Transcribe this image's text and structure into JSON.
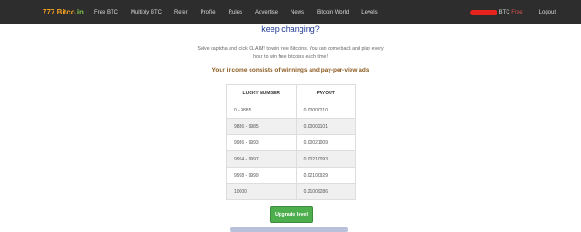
{
  "nav": {
    "brand_num": "777",
    "brand_name": "Bitco",
    "brand_tld": ".in",
    "links": [
      "Free BTC",
      "Multiply BTC",
      "Refer",
      "Profile",
      "Rules",
      "Advertise",
      "News",
      "Bitcoin World",
      "Levels"
    ],
    "btc_label": "BTC",
    "free_label": "Free",
    "logout": "Logout"
  },
  "main": {
    "headline": "keep changing?",
    "intro": "Solve captcha and click CLAIM! to win free Bitcoins. You can come back and play every hour to win free bitcoins each time!",
    "income": "Your income consists of winnings and pay-per-view ads"
  },
  "payout_table": {
    "headers": [
      "LUCKY NUMBER",
      "PAYOUT"
    ],
    "rows": [
      [
        "0 - 9885",
        "0.00000210"
      ],
      [
        "9886 - 9985",
        "0.00002101"
      ],
      [
        "9986 - 9993",
        "0.00021009"
      ],
      [
        "9994 - 9997",
        "0.00210093"
      ],
      [
        "9998 - 9999",
        "0.02100929"
      ],
      [
        "10000",
        "0.21009286"
      ]
    ]
  },
  "upgrade_button": "Upgrade level",
  "colors": {
    "navbar": "#2d2d2d",
    "accent_orange": "#f0a020",
    "accent_green": "#7ec14a",
    "headline_blue": "#1f3a93",
    "income_brown": "#8b5a1f",
    "button_green": "#4cae4c"
  }
}
